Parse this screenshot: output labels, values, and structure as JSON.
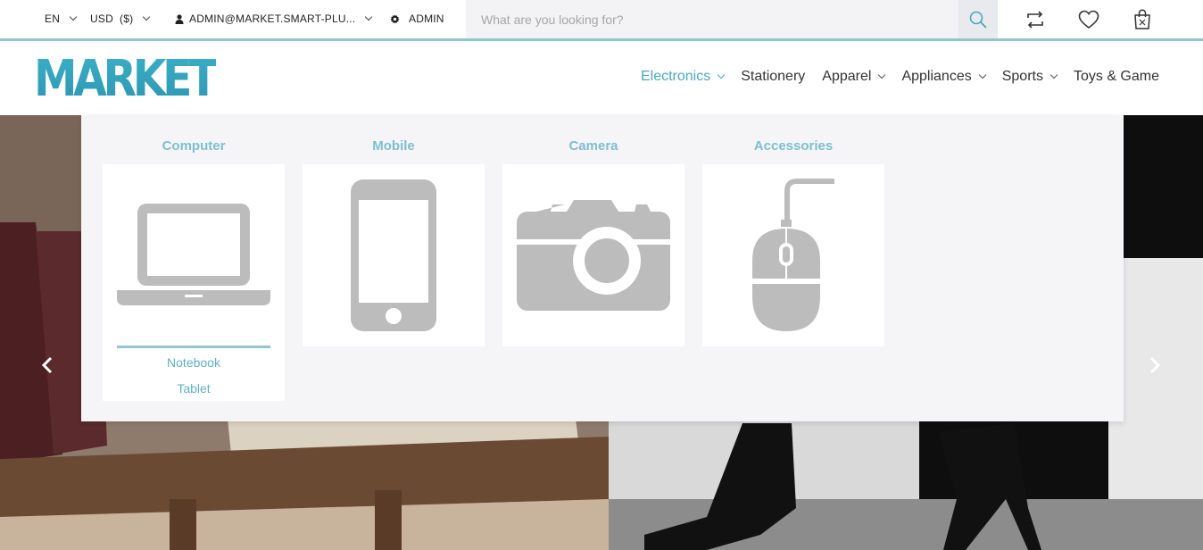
{
  "topbar": {
    "language": "EN",
    "currency": "USD  ($)",
    "account": "ADMIN@MARKET.SMART-PLU...",
    "admin": "ADMIN",
    "search_placeholder": "What are you looking for?"
  },
  "header": {
    "logo_text": "MARKET",
    "nav": [
      {
        "label": "Electronics",
        "has_dropdown": true,
        "active": true
      },
      {
        "label": "Stationery",
        "has_dropdown": false
      },
      {
        "label": "Apparel",
        "has_dropdown": true
      },
      {
        "label": "Appliances",
        "has_dropdown": true
      },
      {
        "label": "Sports",
        "has_dropdown": true
      },
      {
        "label": "Toys & Game",
        "has_dropdown": false
      }
    ]
  },
  "mega_menu": {
    "categories": [
      {
        "title": "Computer",
        "icon": "laptop-icon",
        "subitems": [
          "Notebook",
          "Tablet"
        ]
      },
      {
        "title": "Mobile",
        "icon": "smartphone-icon"
      },
      {
        "title": "Camera",
        "icon": "camera-icon"
      },
      {
        "title": "Accessories",
        "icon": "mouse-icon"
      }
    ]
  },
  "colors": {
    "accent": "#4aa8bd",
    "accent_light": "#8fc6d0",
    "icon_gray": "#bcbcbc"
  }
}
